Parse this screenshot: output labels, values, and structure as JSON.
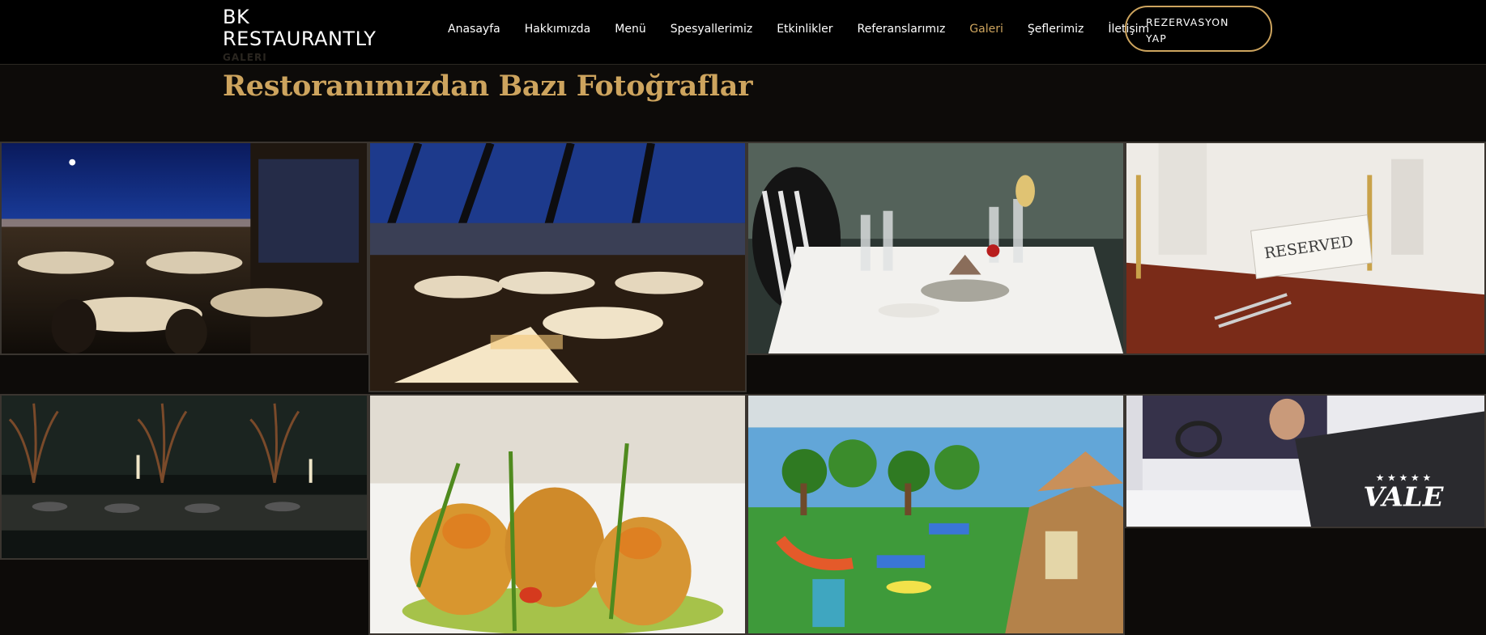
{
  "brand": {
    "line1": "BK",
    "line2": "RESTAURANTLY",
    "section_tag": "GALERI"
  },
  "nav": {
    "items": [
      {
        "label": "Anasayfa"
      },
      {
        "label": "Hakkımızda"
      },
      {
        "label": "Menü"
      },
      {
        "label": "Spesyallerimiz"
      },
      {
        "label": "Etkinlikler"
      },
      {
        "label": "Referanslarımız"
      },
      {
        "label": "Galeri",
        "active": true
      },
      {
        "label": "Şeflerimiz"
      },
      {
        "label": "İletişim"
      }
    ],
    "reserve_button": {
      "line1": "REZERVASYON",
      "line2": "YAP"
    }
  },
  "page": {
    "title": "Restoranımızdan Bazı Fotoğraflar"
  },
  "gallery": {
    "photos": [
      {
        "subject": "night-terrace-bosphorus-view"
      },
      {
        "subject": "glass-roof-dining-hall"
      },
      {
        "subject": "table-setting-candle"
      },
      {
        "subject": "reserved-card-table",
        "sign_text": "RESERVED"
      },
      {
        "subject": "dark-long-table-decor"
      },
      {
        "subject": "stuffed-zucchini-flowers-dish"
      },
      {
        "subject": "kids-playroom"
      },
      {
        "subject": "valet-driver",
        "jacket_text": "VALE"
      }
    ]
  },
  "colors": {
    "accent": "#cda45e",
    "background": "#0d0b09",
    "header": "#000000"
  }
}
